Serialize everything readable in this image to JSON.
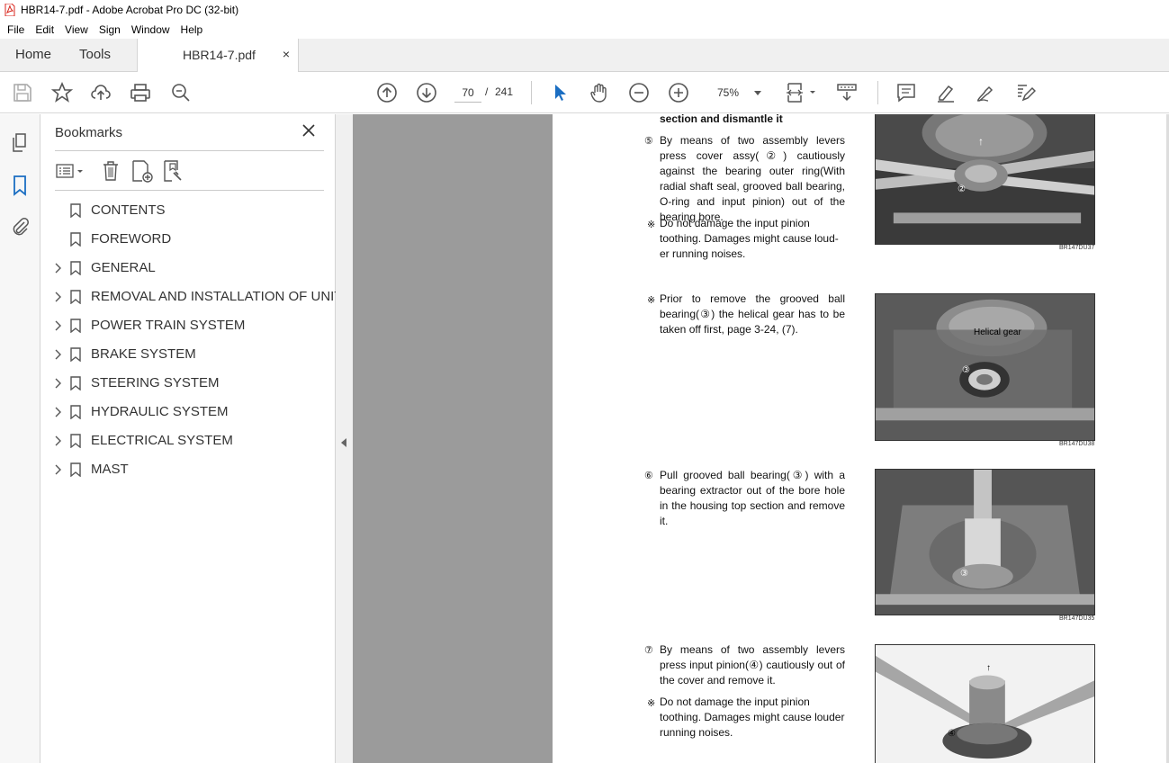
{
  "window": {
    "title": "HBR14-7.pdf - Adobe Acrobat Pro DC (32-bit)"
  },
  "menu": [
    "File",
    "Edit",
    "View",
    "Sign",
    "Window",
    "Help"
  ],
  "tabs": {
    "home": "Home",
    "tools": "Tools",
    "document": "HBR14-7.pdf",
    "close_symbol": "×"
  },
  "toolbar": {
    "current_page": "70",
    "page_separator": "/",
    "total_pages": "241",
    "zoom": "75%"
  },
  "bookmarks": {
    "title": "Bookmarks",
    "items": [
      {
        "label": "CONTENTS",
        "expandable": false
      },
      {
        "label": "FOREWORD",
        "expandable": false
      },
      {
        "label": "GENERAL",
        "expandable": true
      },
      {
        "label": "REMOVAL AND INSTALLATION OF UNIT",
        "expandable": true
      },
      {
        "label": "POWER TRAIN SYSTEM",
        "expandable": true
      },
      {
        "label": "BRAKE SYSTEM",
        "expandable": true
      },
      {
        "label": "STEERING SYSTEM",
        "expandable": true
      },
      {
        "label": "HYDRAULIC SYSTEM",
        "expandable": true
      },
      {
        "label": "ELECTRICAL SYSTEM",
        "expandable": true
      },
      {
        "label": "MAST",
        "expandable": true
      }
    ]
  },
  "document": {
    "heading_tail": "section and dismantle it",
    "step5_marker": "⑤",
    "step5": "By means of two assembly levers press cover assy(②) cautiously against the bearing outer ring(With radial shaft seal, grooved ball bearing, O-ring and input pinion) out of the bearing bore.",
    "note_marker": "※",
    "note1": "Do not damage the input pinion toothing. Damages might cause loud-er running noises.",
    "note2": "Prior to remove the grooved ball bearing(③) the helical gear has to be taken off first, page 3-24, (7).",
    "step6_marker": "⑥",
    "step6": "Pull grooved ball bearing(③) with a bearing extractor out of the bore hole in the housing top section and remove it.",
    "step7_marker": "⑦",
    "step7": "By means of two assembly levers press input pinion(④) cautiously out of the cover and remove it.",
    "note3": "Do not damage the input pinion toothing. Damages might cause louder running noises.",
    "photo_codes": [
      "BR147DU37",
      "BR147DU38",
      "BR147DU35"
    ],
    "photo_labels": {
      "p1_arrow": "↑",
      "p1_num": "②",
      "p2_text": "Helical gear",
      "p2_num": "③",
      "p3_num": "③",
      "p4_arrow": "↑",
      "p4_num": "④"
    }
  }
}
